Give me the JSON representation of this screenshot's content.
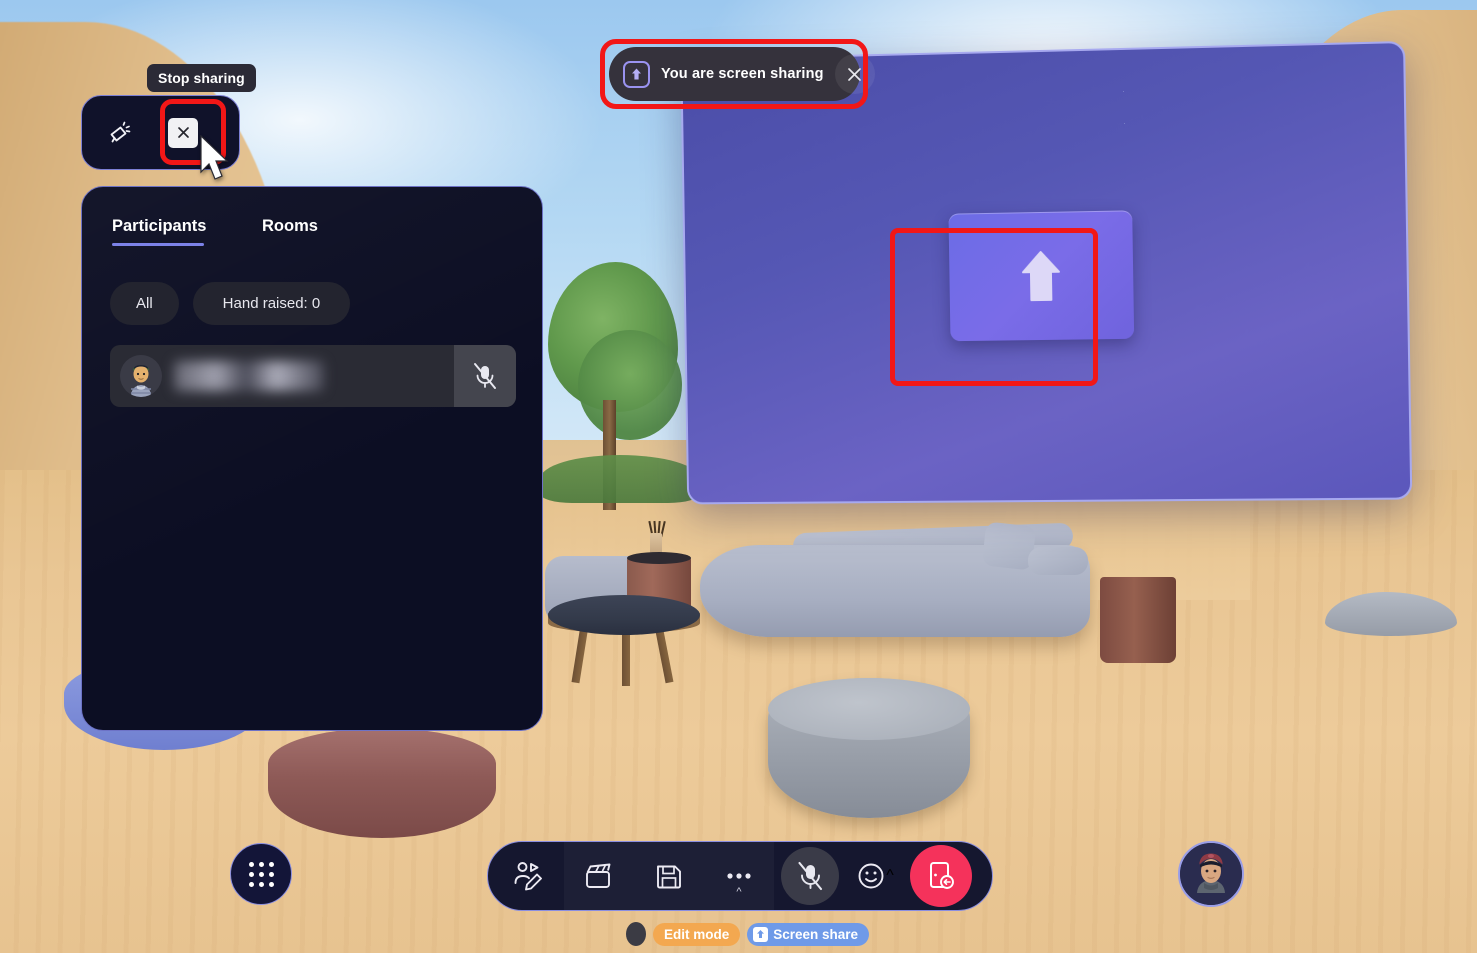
{
  "app": {
    "environment_name": "Virtual lounge 3D space"
  },
  "share_banner": {
    "icon": "screen-share-up-arrow-icon",
    "text": "You are screen sharing",
    "close_label": "✕"
  },
  "tooltip": {
    "text": "Stop sharing"
  },
  "mini_toolbar": {
    "megaphone_icon": "megaphone-icon",
    "close_label": "✕"
  },
  "screen": {
    "placeholder_icon": "upload-arrow-icon",
    "placeholder_label": ""
  },
  "panel": {
    "tabs": [
      {
        "label": "Participants",
        "active": true
      },
      {
        "label": "Rooms",
        "active": false
      }
    ],
    "filters": [
      {
        "label": "All"
      },
      {
        "label": "Hand raised: 0"
      }
    ],
    "participants": [
      {
        "name": "",
        "name_hidden": true,
        "mic_state": "muted",
        "mic_icon": "mic-off-icon",
        "avatar": "avatar-icon"
      }
    ]
  },
  "grid_button": {
    "icon": "apps-grid-icon"
  },
  "bottom_toolbar": {
    "buttons": [
      {
        "name": "edit-avatar",
        "icon": "avatar-edit-icon",
        "label": ""
      },
      {
        "name": "effects",
        "icon": "clapperboard-icon",
        "label": ""
      },
      {
        "name": "save",
        "icon": "floppy-disk-icon",
        "label": ""
      },
      {
        "name": "more",
        "icon": "ellipsis-icon",
        "label": "",
        "chevron": "^"
      },
      {
        "name": "microphone",
        "icon": "mic-off-icon",
        "label": "",
        "state": "muted"
      },
      {
        "name": "reactions",
        "icon": "smiley-icon",
        "label": "",
        "chevron": "^"
      },
      {
        "name": "leave",
        "icon": "leave-door-icon",
        "label": ""
      }
    ]
  },
  "status_badges": [
    {
      "label": "Edit mode",
      "color": "#f3a850",
      "icon": ""
    },
    {
      "label": "Screen share",
      "color": "#6f9ae8",
      "icon": "screen-share-up-arrow-icon"
    }
  ],
  "user_avatar": {
    "alt": "user-avatar"
  },
  "colors": {
    "accent_purple": "#7c82e8",
    "panel_bg": "#0c0e23",
    "leave_red": "#f5325b",
    "annotation_red": "#f21717",
    "edit_mode_orange": "#f3a850",
    "screen_share_blue": "#6f9ae8"
  }
}
